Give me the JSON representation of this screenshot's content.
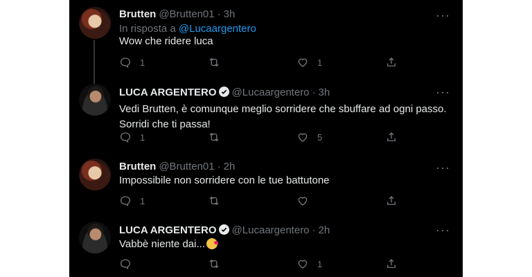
{
  "thread": [
    {
      "name": "Brutten",
      "verified": false,
      "handle": "@Brutten01",
      "time": "3h",
      "reply_to_prefix": "In risposta a ",
      "reply_to_mention": "@Lucaargentero",
      "text": "Wow che ridere luca",
      "replies": "1",
      "retweets": "",
      "likes": "1",
      "more_icon": "ellipsis-icon"
    },
    {
      "name": "LUCA ARGENTERO",
      "verified": true,
      "handle": "@Lucaargentero",
      "time": "3h",
      "text_line1": "Vedi Brutten, è comunque meglio sorridere che sbuffare ad ogni passo.",
      "text_line2": "Sorridi che ti passa!",
      "replies": "1",
      "retweets": "",
      "likes": "5",
      "more_icon": "ellipsis-icon"
    },
    {
      "name": "Brutten",
      "verified": false,
      "handle": "@Brutten01",
      "time": "2h",
      "text": "Impossibile non sorridere con le tue battutone",
      "replies": "1",
      "retweets": "",
      "likes": "",
      "more_icon": "ellipsis-icon"
    },
    {
      "name": "LUCA ARGENTERO",
      "verified": true,
      "handle": "@Lucaargentero",
      "time": "2h",
      "text": "Vabbè niente dai...",
      "emoji": "face-blowing-kiss",
      "replies": "",
      "retweets": "",
      "likes": "1",
      "more_icon": "ellipsis-icon"
    }
  ],
  "separator": "·",
  "more_glyph": "···",
  "colors": {
    "background": "#000000",
    "text": "#e7e9ea",
    "muted": "#71767b",
    "link": "#1d9bf0"
  }
}
